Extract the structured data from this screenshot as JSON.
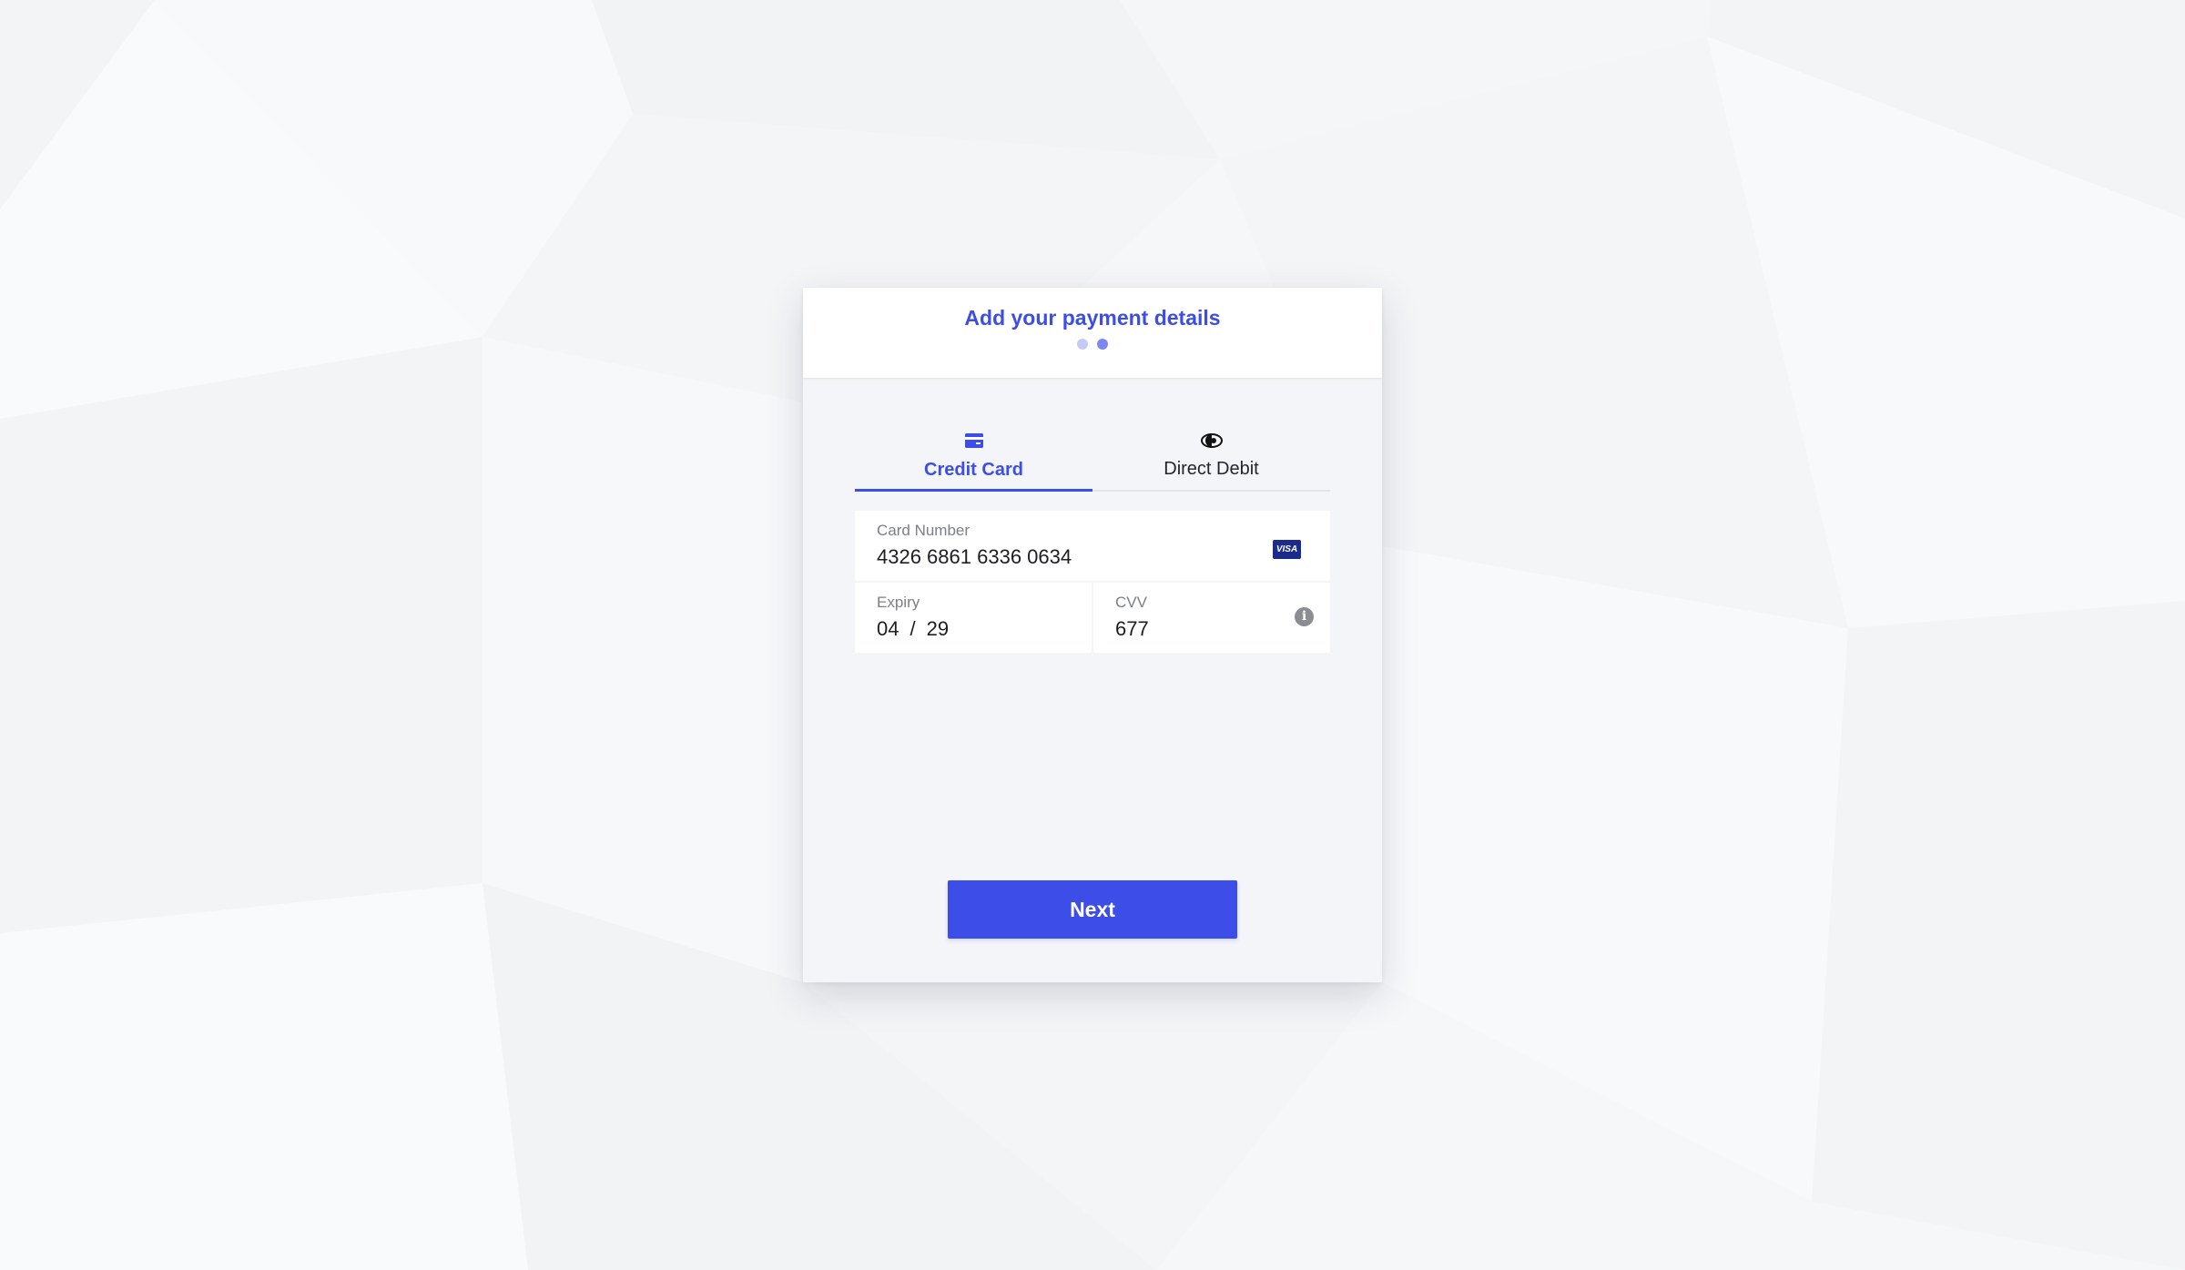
{
  "header": {
    "title": "Add your payment details",
    "steps": [
      {
        "state": "done"
      },
      {
        "state": "active"
      }
    ]
  },
  "tabs": [
    {
      "label": "Credit Card",
      "icon": "credit-card-icon",
      "active": true
    },
    {
      "label": "Direct Debit",
      "icon": "direct-debit-icon",
      "active": false
    }
  ],
  "form": {
    "card_number": {
      "label": "Card Number",
      "value": "4326 6861 6336 0634",
      "brand": "VISA"
    },
    "expiry": {
      "label": "Expiry",
      "month": "04",
      "separator": "/",
      "year": "29"
    },
    "cvv": {
      "label": "CVV",
      "value": "677",
      "icon": "info-icon"
    }
  },
  "actions": {
    "next_label": "Next"
  },
  "colors": {
    "accent": "#3d4ee8",
    "background": "#f6f7f9",
    "card_background": "#f4f5f8"
  }
}
